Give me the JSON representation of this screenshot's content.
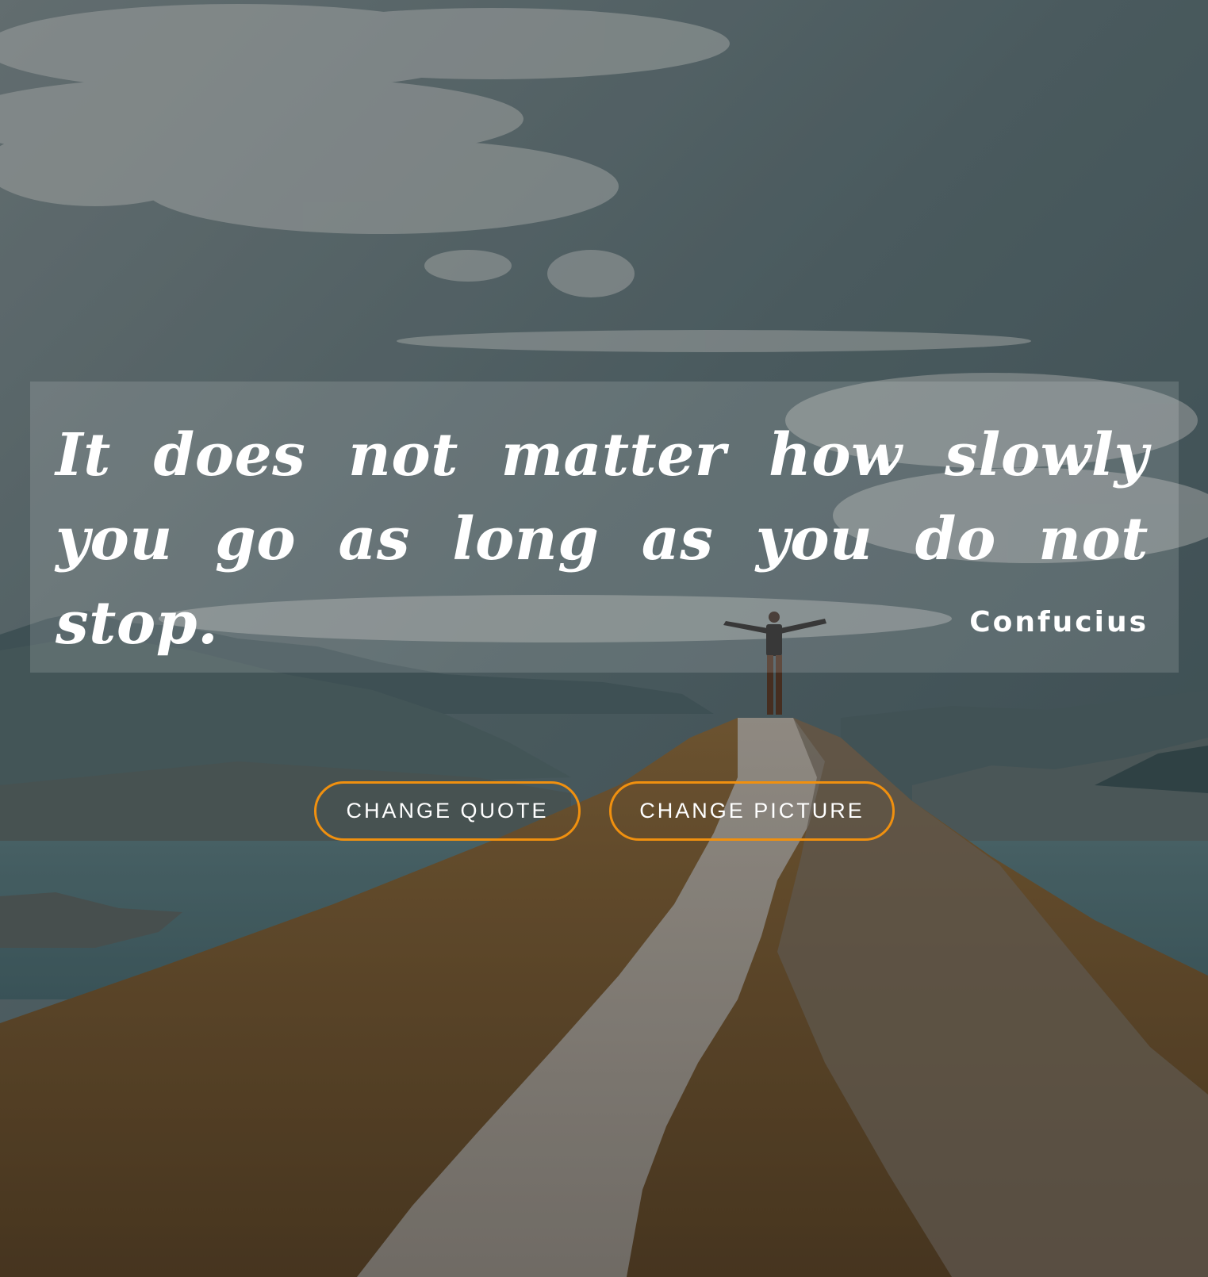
{
  "quote": {
    "text": "It does not matter how slowly you go as long as you do not stop.",
    "author": "Confucius"
  },
  "actions": {
    "change_quote_label": "CHANGE QUOTE",
    "change_picture_label": "CHANGE PICTURE"
  },
  "background": {
    "subject": "hiker with raised arms on mountain ridge above lake under cloudy sky"
  },
  "colors": {
    "button_border": "#f0900f",
    "text": "#ffffff"
  }
}
